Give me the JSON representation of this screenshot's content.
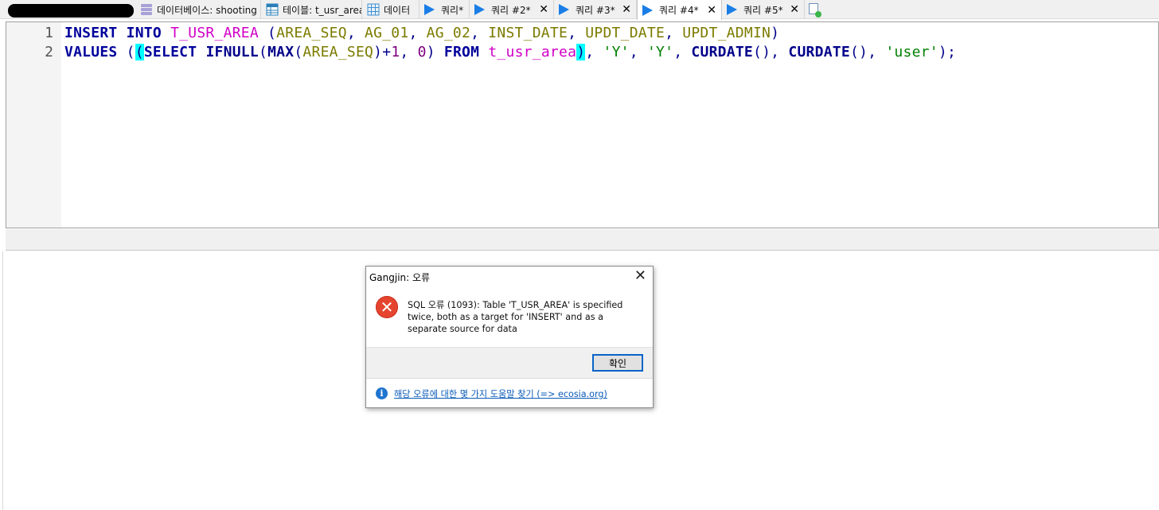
{
  "tabs": [
    {
      "label": "데이터베이스: shooting",
      "icon": "database-icon",
      "closable": false
    },
    {
      "label": "테이블: t_usr_area",
      "icon": "table-icon",
      "closable": false
    },
    {
      "label": "데이터",
      "icon": "grid-icon",
      "closable": false
    },
    {
      "label": "쿼리*",
      "icon": "play-icon",
      "closable": false
    },
    {
      "label": "쿼리 #2*",
      "icon": "play-icon",
      "closable": true
    },
    {
      "label": "쿼리 #3*",
      "icon": "play-icon",
      "closable": true
    },
    {
      "label": "쿼리 #4*",
      "icon": "play-icon",
      "closable": true,
      "active": true
    },
    {
      "label": "쿼리 #5*",
      "icon": "play-icon",
      "closable": true
    }
  ],
  "editor": {
    "line_numbers": [
      "1",
      "2"
    ],
    "line1": {
      "t1": "INSERT",
      "t2": "INTO",
      "t3": "T_USR_AREA",
      "t4": "(",
      "t5": "AREA_SEQ",
      "t6": ", ",
      "t7": "AG_01",
      "t8": ", ",
      "t9": "AG_02",
      "t10": ", ",
      "t11": "INST_DATE",
      "t12": ", ",
      "t13": "UPDT_DATE",
      "t14": ", ",
      "t15": "UPDT_ADMIN",
      "t16": ")"
    },
    "line2": {
      "t1": "VALUES",
      "t2": "(",
      "t3": "(",
      "t4": "SELECT",
      "t5": "IFNULL",
      "t6": "(",
      "t7": "MAX",
      "t8": "(",
      "t9": "AREA_SEQ",
      "t10": ")+",
      "t11": "1",
      "t12": ", ",
      "t13": "0",
      "t14": ") ",
      "t15": "FROM",
      "t16": "t_usr_area",
      "t17": ")",
      "t18": ", ",
      "t19": "'Y'",
      "t20": ", ",
      "t21": "'Y'",
      "t22": ", ",
      "t23": "CURDATE",
      "t24": "(), ",
      "t25": "CURDATE",
      "t26": "(), ",
      "t27": "'user'",
      "t28": ");"
    }
  },
  "dialog": {
    "title": "Gangjin: 오류",
    "close_symbol": "✕",
    "message": "SQL 오류 (1093): Table 'T_USR_AREA' is specified twice, both as a target for 'INSERT' and as a separate source for data",
    "ok_label": "확인",
    "help_link": "해당 오류에 대한 몇 가지 도움말 찾기 (=> ecosia.org)",
    "error_icon": "error-icon",
    "info_icon": "info-icon"
  }
}
